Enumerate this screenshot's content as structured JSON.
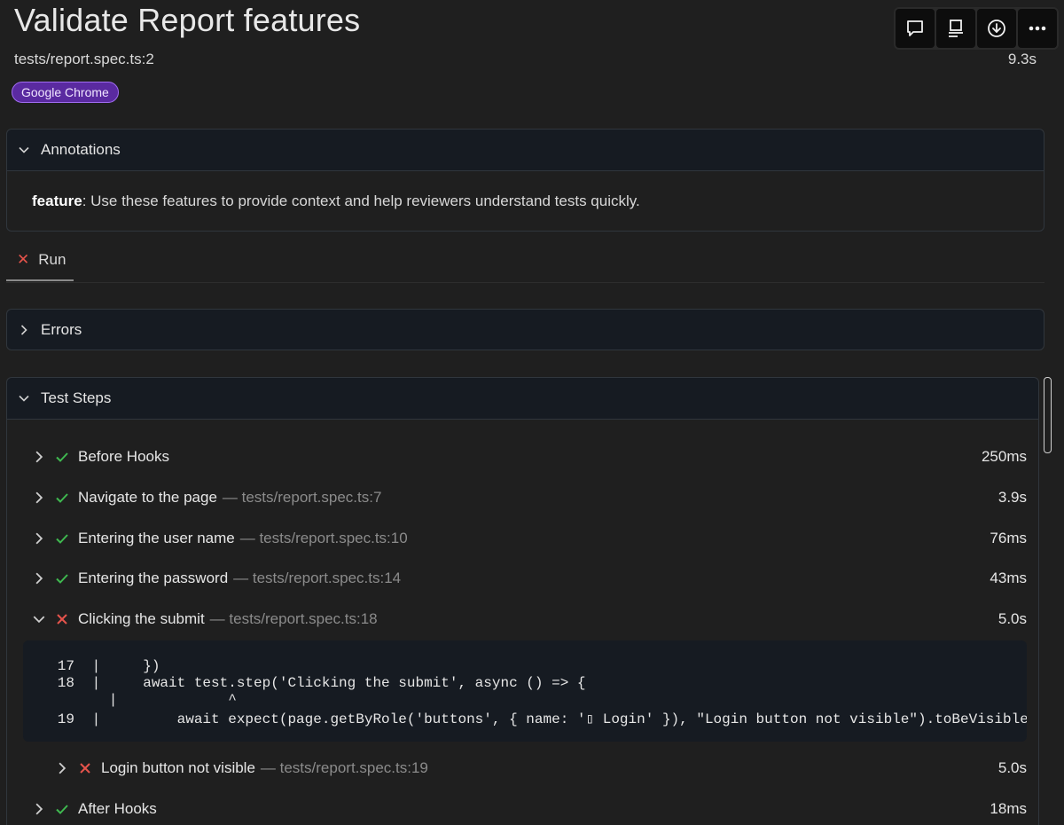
{
  "header": {
    "title": "Validate Report features",
    "file": "tests/report.spec.ts:2",
    "duration": "9.3s",
    "browser_badge": "Google Chrome"
  },
  "toolbar": {
    "buttons": [
      "comment-icon",
      "report-icon",
      "download-icon",
      "more-icon"
    ]
  },
  "annotations": {
    "title": "Annotations",
    "key": "feature",
    "text": ": Use these features to provide context and help reviewers understand tests quickly."
  },
  "run_tab": {
    "label": "Run"
  },
  "errors": {
    "title": "Errors"
  },
  "steps": {
    "title": "Test Steps",
    "items": [
      {
        "status": "pass",
        "label": "Before Hooks",
        "loc": "",
        "time": "250ms",
        "expanded": false
      },
      {
        "status": "pass",
        "label": "Navigate to the page",
        "loc": "— tests/report.spec.ts:7",
        "time": "3.9s",
        "expanded": false
      },
      {
        "status": "pass",
        "label": "Entering the user name",
        "loc": "— tests/report.spec.ts:10",
        "time": "76ms",
        "expanded": false
      },
      {
        "status": "pass",
        "label": "Entering the password",
        "loc": "— tests/report.spec.ts:14",
        "time": "43ms",
        "expanded": false
      },
      {
        "status": "fail",
        "label": "Clicking the submit",
        "loc": "— tests/report.spec.ts:18",
        "time": "5.0s",
        "expanded": true
      },
      {
        "status": "fail",
        "label": "Login button not visible",
        "loc": "— tests/report.spec.ts:19",
        "time": "5.0s",
        "expanded": false
      },
      {
        "status": "pass",
        "label": "After Hooks",
        "loc": "",
        "time": "18ms",
        "expanded": false
      }
    ],
    "code_lines": [
      {
        "num": "17",
        "text": " |     })"
      },
      {
        "num": "18",
        "text": " |     await test.step('Clicking the submit', async () => {"
      },
      {
        "num": "",
        "text": "   |             ^"
      },
      {
        "num": "19",
        "text": " |         await expect(page.getByRole('buttons', { name: '▯ Login' }), \"Login button not visible\").toBeVisible"
      }
    ]
  },
  "colors": {
    "pass": "#3fb950",
    "fail": "#e5534b",
    "badge_bg": "#5a2aa0",
    "badge_border": "#a06cf0"
  }
}
